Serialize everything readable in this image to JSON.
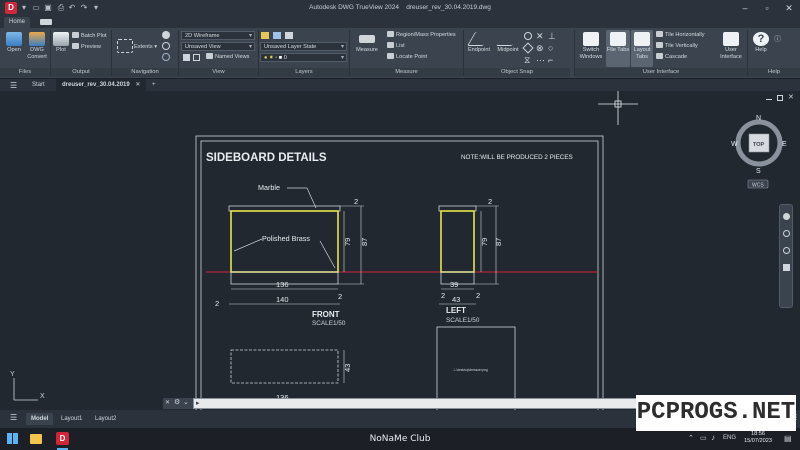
{
  "app": {
    "title": "Autodesk DWG TrueView 2024",
    "filename": "dreuser_rev_30.04.2019.dwg",
    "logo_letter": "D"
  },
  "ribbon_tabs": [
    {
      "label": "Home"
    }
  ],
  "ribbon": {
    "files": {
      "label": "Files",
      "open": "Open",
      "dwg_convert_1": "DWG",
      "dwg_convert_2": "Convert"
    },
    "output": {
      "label": "Output",
      "plot": "Plot",
      "batch_plot": "Batch Plot",
      "preview": "Preview"
    },
    "navigation": {
      "label": "Navigation",
      "extents": "Extents"
    },
    "view": {
      "label": "View",
      "visual_style": "2D Wireframe",
      "saved_view": "Unsaved View",
      "named_views": "Named Views"
    },
    "layers": {
      "label": "Layers",
      "layer_state": "Unsaved Layer State",
      "layer_current": "0"
    },
    "measure": {
      "label": "Measure",
      "measure": "Measure",
      "region_mass": "Region/Mass Properties",
      "list": "List",
      "locate_point": "Locate Point"
    },
    "object_snap": {
      "label": "Object Snap",
      "endpoint": "Endpoint",
      "midpoint": "Midpoint"
    },
    "user_interface": {
      "label": "User Interface",
      "switch_windows_1": "Switch",
      "switch_windows_2": "Windows",
      "file_tabs_1": "File Tabs",
      "layout_tabs_1": "Layout",
      "layout_tabs_2": "Tabs",
      "tile_h": "Tile Horizontally",
      "tile_v": "Tile Vertically",
      "cascade": "Cascade",
      "user_interface_1": "User",
      "user_interface_2": "Interface"
    },
    "help": {
      "label": "Help",
      "help": "Help"
    }
  },
  "doc_tabs": [
    {
      "label": "Start"
    },
    {
      "label": "dreuser_rev_30.04.2019"
    }
  ],
  "doc_tab_add": "+",
  "viewcube": {
    "top": "TOP",
    "n": "N",
    "s": "S",
    "e": "E",
    "w": "W",
    "wcs": "WCS"
  },
  "drawing": {
    "title": "SIDEBOARD DETAILS",
    "note": "NOTE:WILL BE PRODUCED 2 PIECES",
    "marble": "Marble",
    "polished_brass": "Polished Brass",
    "front_dims": {
      "d2a": "2",
      "d79": "79",
      "d87": "87",
      "d136": "136",
      "d140": "140",
      "d2b": "2",
      "d2c": "2"
    },
    "left_dims": {
      "d2a": "2",
      "d79": "79",
      "d87": "87",
      "d39": "39",
      "d43": "43",
      "d2b": "2",
      "d2c": "2"
    },
    "front_label": "FRONT",
    "front_scale": "SCALE1/50",
    "left_label": "LEFT",
    "left_scale": "SCALE1/50",
    "lower_d43": "43",
    "lower_d136": "136",
    "image_ref": "..\\..\\desktop\\dressuer.png",
    "ucs_x": "X",
    "ucs_y": "Y"
  },
  "layout_tabs": [
    {
      "label": "Model"
    },
    {
      "label": "Layout1"
    },
    {
      "label": "Layout2"
    }
  ],
  "taskbar": {
    "center_text": "NoNaMe Club",
    "lang": "ENG",
    "time": "18:56",
    "date": "15/07/2023"
  },
  "watermark": "PCPROGS.NET",
  "colors": {
    "accent": "#d0263a",
    "brass": "#e8e34a",
    "redline": "#d0263a",
    "canvas": "#212830"
  }
}
